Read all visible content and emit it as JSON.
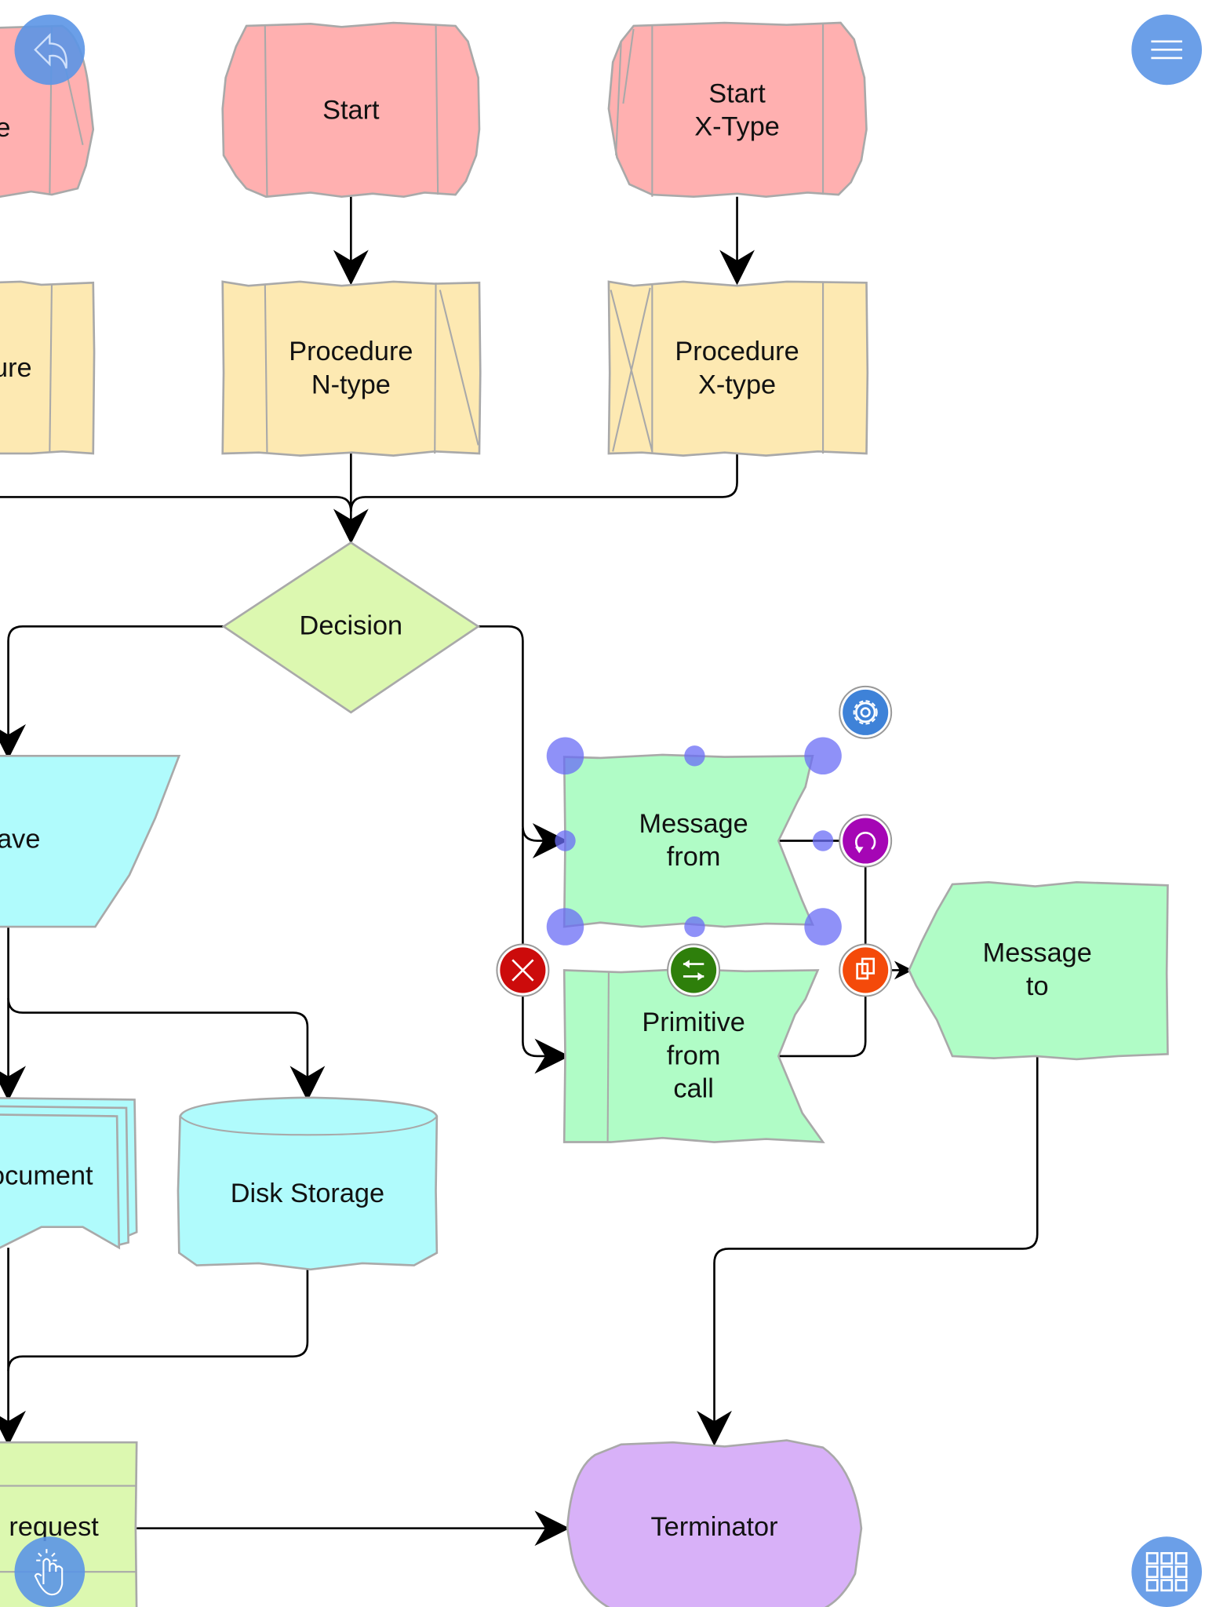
{
  "toolbar": {
    "undo_icon": "undo-arrow-icon",
    "menu_icon": "hamburger-menu-icon",
    "touch_icon": "hand-pointer-icon",
    "grid_icon": "grid-icon"
  },
  "nodes": {
    "start_partial": {
      "line1": "e"
    },
    "start": {
      "line1": "Start"
    },
    "start_x": {
      "line1": "Start",
      "line2": "X-Type"
    },
    "procedure_partial": {
      "line1": "ure"
    },
    "procedure_n": {
      "line1": "Procedure",
      "line2": "N-type"
    },
    "procedure_x": {
      "line1": "Procedure",
      "line2": "X-type"
    },
    "decision": {
      "line1": "Decision"
    },
    "save_partial": {
      "line1": "ave"
    },
    "document_partial": {
      "line1": "ocument"
    },
    "disk_storage": {
      "line1": "Disk Storage"
    },
    "request_partial": {
      "line1": "request"
    },
    "terminator": {
      "line1": "Terminator"
    },
    "message_from": {
      "line1": "Message",
      "line2": "from"
    },
    "primitive_from_call": {
      "line1": "Primitive",
      "line2": "from",
      "line3": "call"
    },
    "message_to": {
      "line1": "Message",
      "line2": "to"
    }
  },
  "colors": {
    "start": "#ffb0b0",
    "procedure": "#fde9b2",
    "decision": "#dcf8b0",
    "data": "#b0fbfc",
    "message": "#b0fcc6",
    "terminator": "#d8b1f8",
    "selection_handle": "#6a6cf5",
    "settings": "#3e82d8",
    "rotate": "#a506b5",
    "delete": "#cc0b0b",
    "swap": "#2e7f0b",
    "copy": "#f44a0a"
  },
  "selection_tools": {
    "settings_icon": "gear-icon",
    "rotate_icon": "rotate-icon",
    "delete_icon": "close-x-icon",
    "swap_icon": "swap-arrows-icon",
    "copy_icon": "duplicate-icon"
  }
}
